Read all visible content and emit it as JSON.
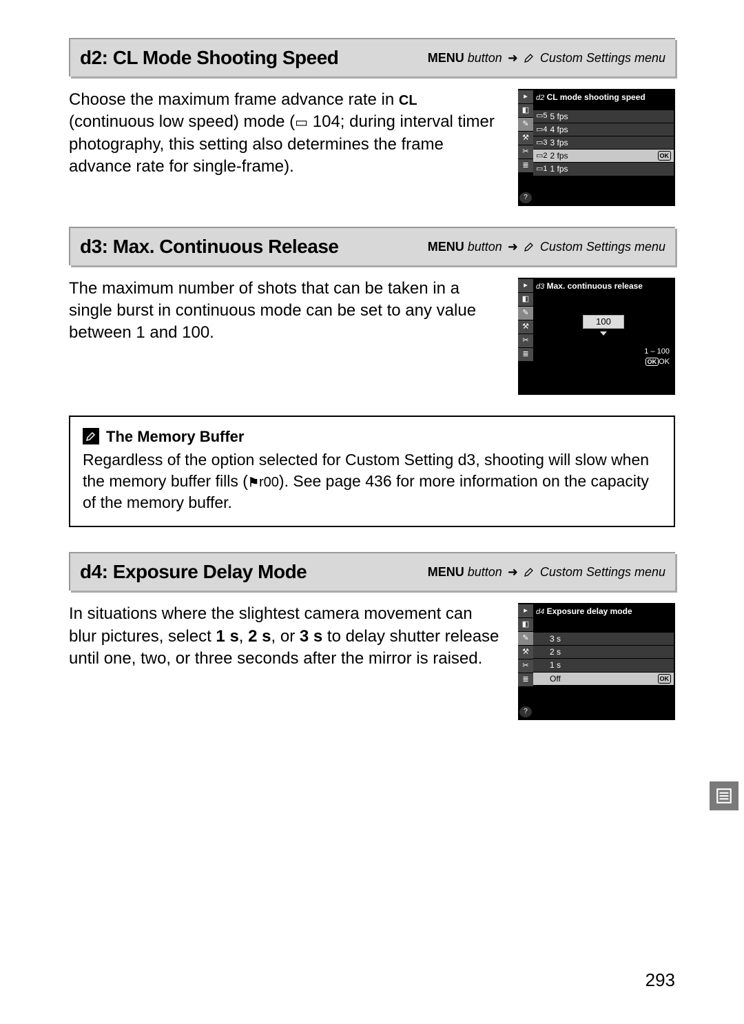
{
  "breadcrumb": {
    "menu_label": "MENU",
    "button_word": "button",
    "arrow": "➜",
    "menu_name": "Custom Settings menu"
  },
  "d2": {
    "title": "d2: CL Mode Shooting Speed",
    "para_before": "Choose the maximum frame advance rate in ",
    "cl_label": "CL",
    "para_mid1": " (continuous low speed) mode (",
    "page_ref": " 104; during interval timer photography, this setting also determines the frame advance rate for single-frame).",
    "lcd": {
      "prefix": "d2",
      "title": "CL mode shooting speed",
      "rows": [
        {
          "n": "5",
          "label": "5 fps",
          "sel": false
        },
        {
          "n": "4",
          "label": "4 fps",
          "sel": false
        },
        {
          "n": "3",
          "label": "3 fps",
          "sel": false
        },
        {
          "n": "2",
          "label": "2 fps",
          "sel": true
        },
        {
          "n": "1",
          "label": "1 fps",
          "sel": false
        }
      ],
      "ok": "OK"
    }
  },
  "d3": {
    "title": "d3: Max.  Continuous Release",
    "para": "The maximum number of shots that can be taken in a single burst in continuous mode can be set to any value between 1 and 100.",
    "lcd": {
      "prefix": "d3",
      "title": "Max. continuous release",
      "value": "100",
      "range": "1 – 100",
      "ok": "OK"
    }
  },
  "note": {
    "title": "The Memory Buffer",
    "text_before": "Regardless of the option selected for Custom Setting d3, shooting will slow when the memory buffer fills (",
    "r00": "r00",
    "text_after": ").  See page 436 for more information on the capacity of the memory buffer."
  },
  "d4": {
    "title": "d4: Exposure Delay Mode",
    "para_before": "In situations where the slightest camera movement can blur pictures, select ",
    "b1": "1 s",
    "comma1": ", ",
    "b2": "2 s",
    "comma2": ", or ",
    "b3": "3 s",
    "para_after": " to delay shutter release until one, two, or three seconds after the mirror is raised.",
    "lcd": {
      "prefix": "d4",
      "title": "Exposure delay mode",
      "rows": [
        {
          "label": "3 s",
          "sel": false
        },
        {
          "label": "2 s",
          "sel": false
        },
        {
          "label": "1 s",
          "sel": false
        },
        {
          "label": "Off",
          "sel": true
        }
      ],
      "ok": "OK"
    }
  },
  "page_number": "293"
}
